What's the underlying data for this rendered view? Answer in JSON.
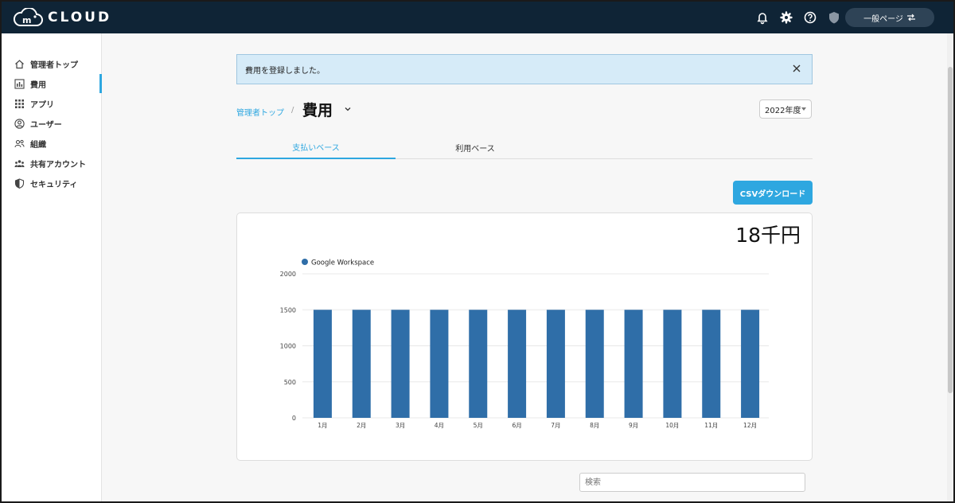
{
  "header": {
    "logo_text": "CLOUD",
    "logo_mark": "m",
    "switch_label": "一般ページ"
  },
  "sidebar": {
    "items": [
      {
        "label": "管理者トップ",
        "icon": "home-icon"
      },
      {
        "label": "費用",
        "icon": "bar-chart-icon"
      },
      {
        "label": "アプリ",
        "icon": "grid-icon"
      },
      {
        "label": "ユーザー",
        "icon": "user-icon"
      },
      {
        "label": "組織",
        "icon": "group-icon"
      },
      {
        "label": "共有アカウント",
        "icon": "shared-account-icon"
      },
      {
        "label": "セキュリティ",
        "icon": "shield-icon"
      }
    ],
    "active_index": 1
  },
  "alert": {
    "message": "費用を登録しました。"
  },
  "breadcrumb": {
    "parent": "管理者トップ",
    "separator": "/"
  },
  "page": {
    "title": "費用",
    "year": "2022年度"
  },
  "tabs": [
    {
      "label": "支払いベース",
      "active": true
    },
    {
      "label": "利用ベース",
      "active": false
    }
  ],
  "actions": {
    "csv_label": "CSVダウンロード"
  },
  "summary": {
    "total": "18千円"
  },
  "search": {
    "placeholder": "検索"
  },
  "colors": {
    "accent": "#2ea7e0",
    "bar": "#2f6ea8",
    "header_bg": "#0f2436"
  },
  "chart_data": {
    "type": "bar",
    "categories": [
      "1月",
      "2月",
      "3月",
      "4月",
      "5月",
      "6月",
      "7月",
      "8月",
      "9月",
      "10月",
      "11月",
      "12月"
    ],
    "series": [
      {
        "name": "Google Workspace",
        "values": [
          1500,
          1500,
          1500,
          1500,
          1500,
          1500,
          1500,
          1500,
          1500,
          1500,
          1500,
          1500
        ]
      }
    ],
    "yticks": [
      0,
      500,
      1000,
      1500,
      2000
    ],
    "ylim": [
      0,
      2000
    ],
    "legend": "top-left",
    "grid": true
  }
}
